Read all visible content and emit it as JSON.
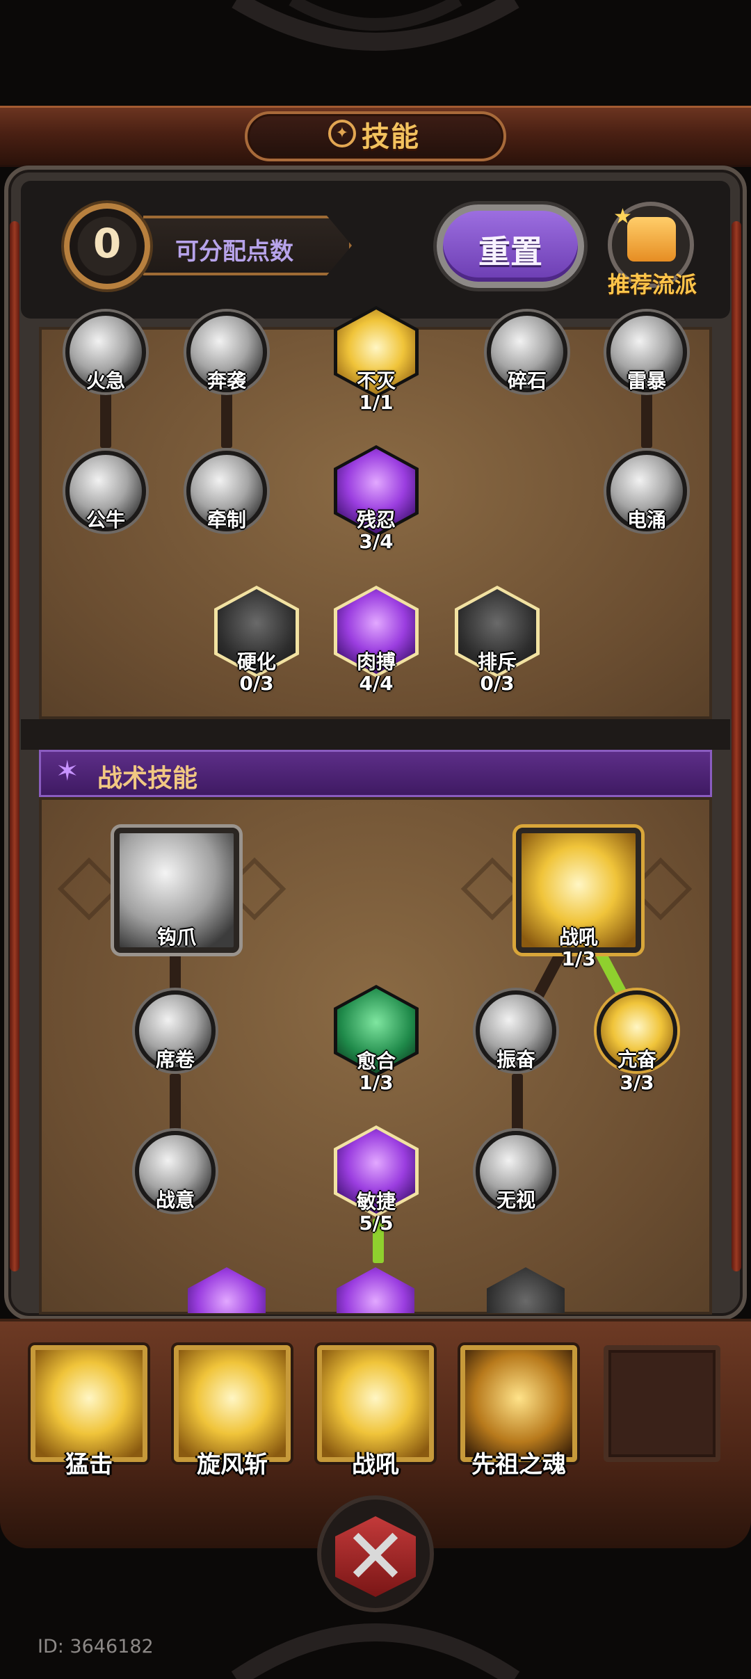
{
  "header": {
    "title": "技能"
  },
  "points": {
    "value": "0",
    "label": "可分配点数"
  },
  "buttons": {
    "reset": "重置",
    "recommend": "推荐流派"
  },
  "core_skills": [
    {
      "name": "火急",
      "count": ""
    },
    {
      "name": "奔袭",
      "count": ""
    },
    {
      "name": "不灭",
      "count": "1/1"
    },
    {
      "name": "碎石",
      "count": ""
    },
    {
      "name": "雷暴",
      "count": ""
    },
    {
      "name": "公牛",
      "count": ""
    },
    {
      "name": "牵制",
      "count": ""
    },
    {
      "name": "残忍",
      "count": "3/4"
    },
    {
      "name": "电涌",
      "count": ""
    },
    {
      "name": "硬化",
      "count": "0/3"
    },
    {
      "name": "肉搏",
      "count": "4/4"
    },
    {
      "name": "排斥",
      "count": "0/3"
    }
  ],
  "tactical": {
    "title": "战术技能",
    "skills": [
      {
        "name": "钩爪",
        "count": ""
      },
      {
        "name": "战吼",
        "count": "1/3"
      },
      {
        "name": "席卷",
        "count": ""
      },
      {
        "name": "愈合",
        "count": "1/3"
      },
      {
        "name": "振奋",
        "count": ""
      },
      {
        "name": "亢奋",
        "count": "3/3"
      },
      {
        "name": "战意",
        "count": ""
      },
      {
        "name": "敏捷",
        "count": "5/5"
      },
      {
        "name": "无视",
        "count": ""
      }
    ]
  },
  "active_bar": [
    {
      "name": "猛击"
    },
    {
      "name": "旋风斩"
    },
    {
      "name": "战吼"
    },
    {
      "name": "先祖之魂"
    },
    {
      "name": ""
    }
  ],
  "footer": {
    "id_text": "ID: 3646182"
  },
  "colors": {
    "accent_gold": "#f3c25e",
    "accent_purple": "#9c6ee0",
    "learned_link": "#8fd02e"
  }
}
